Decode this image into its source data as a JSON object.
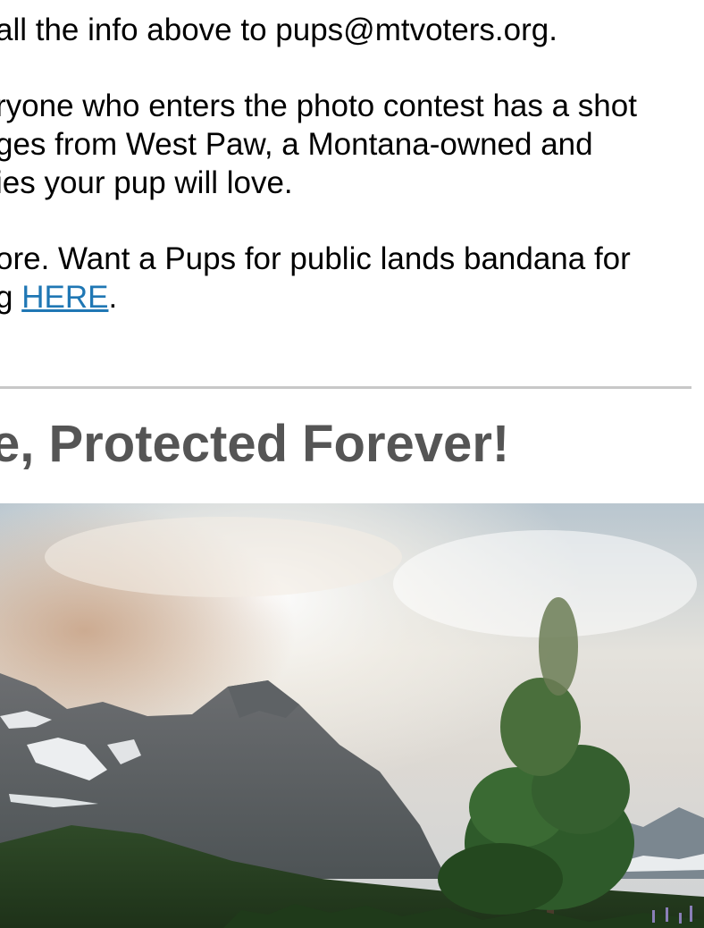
{
  "paragraphs": {
    "p1": {
      "line1": "all the info above to pups@mtvoters.org."
    },
    "p2": {
      "line1": "ryone who enters the photo contest has a shot",
      "line2": "ges from West Paw, a Montana-owned and",
      "line3": "ies your pup will love."
    },
    "p3": {
      "line1": "ore. Want a Pups for public lands bandana for",
      "line2_prefix": "g ",
      "link_text": "HERE",
      "line2_suffix": "."
    }
  },
  "section": {
    "heading": "e, Protected Forever!"
  },
  "colors": {
    "link": "#1f77b4",
    "heading": "#555555",
    "rule": "#c8c8c8"
  }
}
